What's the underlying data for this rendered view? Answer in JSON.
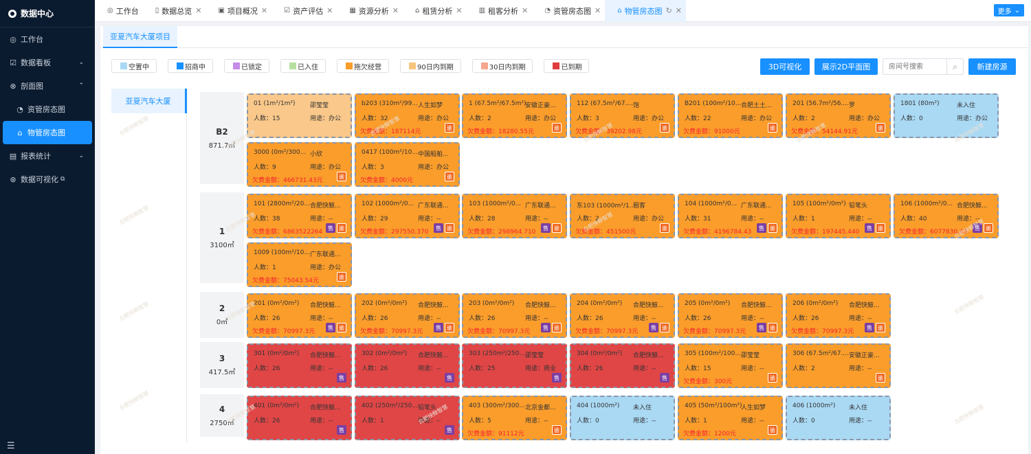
{
  "sidebar": {
    "brand": "数据中心",
    "items": [
      {
        "label": "工作台",
        "icon": "dashboard-icon"
      },
      {
        "label": "数据看板",
        "icon": "chart-icon"
      },
      {
        "label": "剖面图",
        "icon": "section-icon"
      },
      {
        "label": "资管房态图",
        "icon": "asset-icon"
      },
      {
        "label": "物管房态图",
        "icon": "home-icon"
      },
      {
        "label": "报表统计",
        "icon": "report-icon"
      },
      {
        "label": "数据可视化",
        "icon": "visual-icon"
      }
    ]
  },
  "tabs": [
    {
      "label": "工作台",
      "icon": "dashboard-icon"
    },
    {
      "label": "数据总览",
      "icon": "overview-icon"
    },
    {
      "label": "项目概况",
      "icon": "project-icon"
    },
    {
      "label": "资产评估",
      "icon": "assess-icon"
    },
    {
      "label": "资源分析",
      "icon": "resource-icon"
    },
    {
      "label": "租赁分析",
      "icon": "lease-icon"
    },
    {
      "label": "租客分析",
      "icon": "tenant-icon"
    },
    {
      "label": "资管房态图",
      "icon": "asset-icon"
    },
    {
      "label": "物管房态图",
      "icon": "home-icon"
    }
  ],
  "more_label": "更多",
  "project_tab": "亚夏汽车大厦项目",
  "legend": [
    {
      "label": "空置中",
      "color": "#a8d8f5"
    },
    {
      "label": "招商中",
      "color": "#1890ff"
    },
    {
      "label": "已锁定",
      "color": "#c58ce6"
    },
    {
      "label": "已入住",
      "color": "#b7e0a0"
    },
    {
      "label": "拖欠经营",
      "color": "#fa9d2b"
    },
    {
      "label": "90日内到期",
      "color": "#f7c47e"
    },
    {
      "label": "30日内到期",
      "color": "#f6a68d"
    },
    {
      "label": "已到期",
      "color": "#e03c3c"
    }
  ],
  "actions": {
    "visual_3d": "3D可视化",
    "plan_2d": "展示2D平面图",
    "search_placeholder": "房间号搜索",
    "new_room": "新建房源"
  },
  "building": "亚夏汽车大厦",
  "labels": {
    "people": "人数：",
    "use": "用途：",
    "debt": "欠费金额：",
    "sale_badge": "售",
    "overdue_badge": "逾"
  },
  "watermark": "合肥快鲸智慧",
  "floors": [
    {
      "name": "B2",
      "area": "871.7㎡",
      "rooms": [
        {
          "title": "01 (1m²/1m²)",
          "tenant": "邵莹莹",
          "people": "15",
          "use": "办公",
          "status": "light"
        },
        {
          "title": "b203 (310m²/99...",
          "tenant": "人生如梦",
          "people": "32",
          "use": "办公",
          "debt": "187114元",
          "status": "orange"
        },
        {
          "title": "1 (67.5m²/67.5m²)",
          "tenant": "安徽正豪...",
          "people": "2",
          "use": "办公",
          "debt": "18280.55元",
          "status": "orange"
        },
        {
          "title": "112 (67.5m²/67....",
          "tenant": "饱",
          "people": "3",
          "use": "办公",
          "debt": "39202.98元",
          "status": "orange"
        },
        {
          "title": "B201 (100m²/10...",
          "tenant": "合肥土土...",
          "people": "22",
          "use": "办公",
          "debt": "91000元",
          "status": "orange"
        },
        {
          "title": "201 (56.7m²/56....",
          "tenant": "罗",
          "people": "2",
          "use": "办公",
          "debt": "54144.91元",
          "status": "orange"
        },
        {
          "title": "1801 (80m²)",
          "tenant": "未入住",
          "people": "0",
          "use": "办公",
          "status": "blue"
        },
        {
          "title": "3000 (0m²/300...",
          "tenant": "小欣",
          "people": "9",
          "use": "办公",
          "debt": "466731.43元",
          "status": "orange"
        },
        {
          "title": "0417 (100m²/10...",
          "tenant": "中国船舶...",
          "people": "3",
          "use": "办公",
          "debt": "4000元",
          "status": "orange"
        }
      ]
    },
    {
      "name": "1",
      "area": "3100㎡",
      "rooms": [
        {
          "title": "101 (2800m²/20...",
          "tenant": "合肥快鲸...",
          "people": "38",
          "use": "--",
          "debt": "6863522264",
          "sale": true,
          "status": "orange"
        },
        {
          "title": "102 (1000m²/0...",
          "tenant": "广东联通...",
          "people": "29",
          "use": "--",
          "debt": "297550.370",
          "sale": true,
          "status": "orange"
        },
        {
          "title": "103 (1000m²/0...",
          "tenant": "广东联通...",
          "people": "28",
          "use": "--",
          "debt": "298964.710",
          "sale": true,
          "status": "orange"
        },
        {
          "title": "东103 (1000m²/1...",
          "tenant": "租客",
          "people": "2",
          "use": "办公",
          "debt": "451500元",
          "status": "orange"
        },
        {
          "title": "104 (1000m²/0...",
          "tenant": "广东联通...",
          "people": "31",
          "use": "--",
          "debt": "4196784.43",
          "sale": true,
          "status": "orange"
        },
        {
          "title": "105 (100m²/0m²)",
          "tenant": "铅笔头",
          "people": "1",
          "use": "--",
          "debt": "197445.440",
          "sale": true,
          "status": "orange"
        },
        {
          "title": "106 (1000m²/0...",
          "tenant": "合肥快鲸...",
          "people": "40",
          "use": "--",
          "debt": "6077830.43",
          "sale": true,
          "status": "orange"
        },
        {
          "title": "1009 (100m²/10...",
          "tenant": "广东联通...",
          "people": "1",
          "use": "办公",
          "debt": "75043.54元",
          "status": "orange"
        }
      ]
    },
    {
      "name": "2",
      "area": "0㎡",
      "rooms": [
        {
          "title": "201 (0m²/0m²)",
          "tenant": "合肥快鲸...",
          "people": "26",
          "use": "--",
          "debt": "70997.3元",
          "sale": true,
          "status": "orange"
        },
        {
          "title": "202 (0m²/0m²)",
          "tenant": "合肥快鲸...",
          "people": "26",
          "use": "--",
          "debt": "70997.3元",
          "sale": true,
          "status": "orange"
        },
        {
          "title": "203 (0m²/0m²)",
          "tenant": "合肥快鲸...",
          "people": "26",
          "use": "--",
          "debt": "70997.3元",
          "sale": true,
          "status": "orange"
        },
        {
          "title": "204 (0m²/0m²)",
          "tenant": "合肥快鲸...",
          "people": "26",
          "use": "--",
          "debt": "70997.3元",
          "sale": true,
          "status": "orange"
        },
        {
          "title": "205 (0m²/0m²)",
          "tenant": "合肥快鲸...",
          "people": "26",
          "use": "--",
          "debt": "70997.3元",
          "sale": true,
          "status": "orange"
        },
        {
          "title": "206 (0m²/0m²)",
          "tenant": "合肥快鲸...",
          "people": "26",
          "use": "--",
          "debt": "70997.3元",
          "sale": true,
          "status": "orange"
        }
      ]
    },
    {
      "name": "3",
      "area": "417.5㎡",
      "rooms": [
        {
          "title": "301 (0m²/0m²)",
          "tenant": "合肥快鲸...",
          "people": "26",
          "use": "--",
          "sale": true,
          "status": "red"
        },
        {
          "title": "302 (0m²/0m²)",
          "tenant": "合肥快鲸...",
          "people": "26",
          "use": "--",
          "sale": true,
          "status": "red"
        },
        {
          "title": "303 (250m²/250...",
          "tenant": "邵莹莹",
          "people": "25",
          "use": "商业",
          "sale": true,
          "status": "red"
        },
        {
          "title": "304 (0m²/0m²)",
          "tenant": "合肥快鲸...",
          "people": "26",
          "use": "--",
          "sale": true,
          "status": "red"
        },
        {
          "title": "305 (100m²/100...",
          "tenant": "邵莹莹",
          "people": "15",
          "use": "--",
          "debt": "300元",
          "status": "orange"
        },
        {
          "title": "306 (67.5m²/67....",
          "tenant": "安徽正豪...",
          "people": "2",
          "use": "--",
          "overdue": true,
          "status": "orange"
        }
      ]
    },
    {
      "name": "4",
      "area": "2750㎡",
      "rooms": [
        {
          "title": "401 (0m²/0m²)",
          "tenant": "合肥快鲸...",
          "people": "26",
          "use": "--",
          "sale": true,
          "status": "red"
        },
        {
          "title": "402 (250m²/250...",
          "tenant": "铅笔头",
          "people": "1",
          "use": "--",
          "sale": true,
          "status": "red"
        },
        {
          "title": "403 (300m²/300...",
          "tenant": "北京金都...",
          "people": "5",
          "use": "--",
          "debt": "91112元",
          "status": "orange"
        },
        {
          "title": "404 (1000m²)",
          "tenant": "未入住",
          "people": "0",
          "use": "--",
          "status": "blue"
        },
        {
          "title": "405 (50m²/100m²)",
          "tenant": "人生如梦",
          "people": "1",
          "use": "--",
          "debt": "1200元",
          "status": "orange"
        },
        {
          "title": "406 (1000m²)",
          "tenant": "未入住",
          "people": "0",
          "use": "--",
          "status": "blue"
        }
      ]
    }
  ]
}
